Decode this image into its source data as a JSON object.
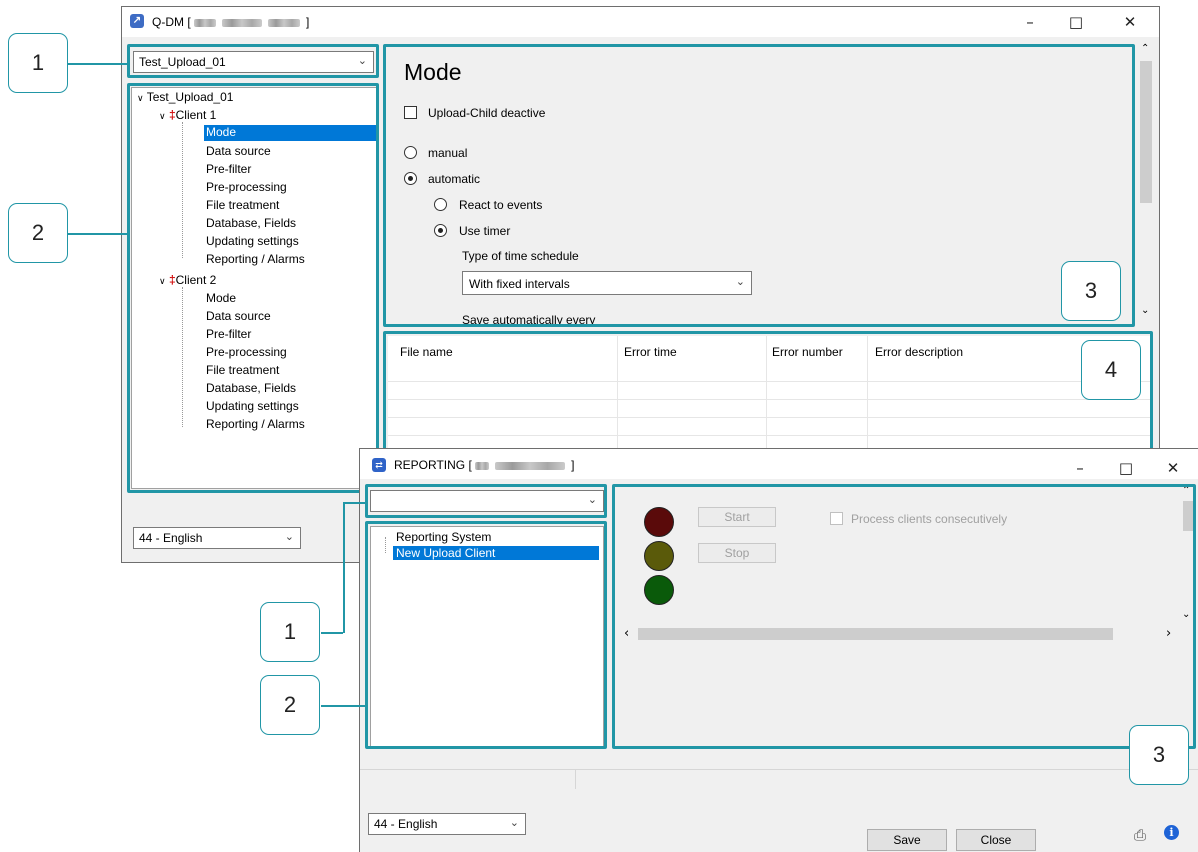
{
  "main_window": {
    "title": "Q-DM [",
    "title_end": "]",
    "profile_combo": "Test_Upload_01",
    "tree": {
      "root": "Test_Upload_01",
      "clients": [
        {
          "label": "Client 1",
          "items": [
            "Mode",
            "Data source",
            "Pre-filter",
            "Pre-processing",
            "File treatment",
            "Database, Fields",
            "Updating settings",
            "Reporting / Alarms"
          ]
        },
        {
          "label": "Client 2",
          "items": [
            "Mode",
            "Data source",
            "Pre-filter",
            "Pre-processing",
            "File treatment",
            "Database, Fields",
            "Updating settings",
            "Reporting / Alarms"
          ]
        }
      ]
    },
    "mode": {
      "heading": "Mode",
      "upload_child_deactive": "Upload-Child deactive",
      "manual": "manual",
      "automatic": "automatic",
      "react_to_events": "React to events",
      "use_timer": "Use timer",
      "schedule_label": "Type of time schedule",
      "schedule_value": "With fixed intervals",
      "save_every": "Save automatically every"
    },
    "error_table": {
      "columns": [
        "File name",
        "Error time",
        "Error number",
        "Error description"
      ]
    },
    "language": "44 - English"
  },
  "reporting_window": {
    "title": "REPORTING [",
    "title_end": "]",
    "combo_value": "",
    "tree_items": [
      "Reporting System",
      "New Upload Client"
    ],
    "start_label": "Start",
    "stop_label": "Stop",
    "process_consecutively": "Process clients consecutively",
    "language": "44 - English",
    "save_label": "Save",
    "close_label": "Close"
  },
  "callouts": [
    "1",
    "2",
    "3",
    "4",
    "1",
    "2",
    "3"
  ],
  "colors": {
    "accent": "#2196a6",
    "selection": "#0078d7",
    "light_red": "#5a0a0a",
    "light_yellow": "#5a5a0a",
    "light_green": "#0a5a0a"
  }
}
